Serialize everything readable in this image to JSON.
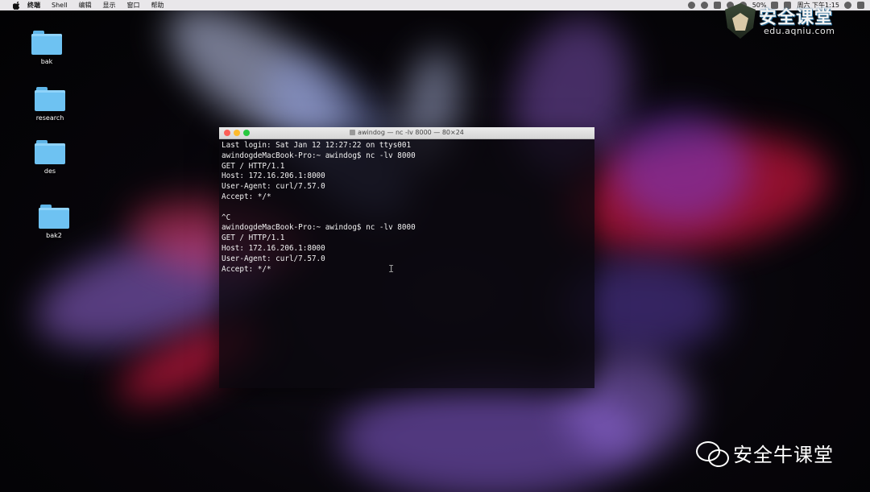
{
  "menubar": {
    "items": [
      "终端",
      "Shell",
      "编辑",
      "显示",
      "窗口",
      "帮助"
    ],
    "battery": "50%",
    "clock": "周六 下午1:15"
  },
  "desktop": {
    "items": [
      {
        "label": "bak"
      },
      {
        "label": "research"
      },
      {
        "label": "des"
      },
      {
        "label": "bak2"
      }
    ]
  },
  "terminal": {
    "title": "awindog — nc -lv 8000 — 80×24",
    "lines": [
      "Last login: Sat Jan 12 12:27:22 on ttys001",
      "awindogdeMacBook-Pro:~ awindog$ nc -lv 8000",
      "GET / HTTP/1.1",
      "Host: 172.16.206.1:8000",
      "User-Agent: curl/7.57.0",
      "Accept: */*",
      "",
      "^C",
      "awindogdeMacBook-Pro:~ awindog$ nc -lv 8000",
      "GET / HTTP/1.1",
      "Host: 172.16.206.1:8000",
      "User-Agent: curl/7.57.0",
      "Accept: */*"
    ]
  },
  "watermarks": {
    "logo_text": "安全课堂",
    "logo_url": "edu.aqniu.com",
    "wechat_text": "安全牛课堂"
  },
  "colors": {
    "folder": "#6ec2f2",
    "terminal_bg": "#0a080e",
    "close": "#fc5f57",
    "minimize": "#fdbb2e",
    "zoom": "#28c840"
  }
}
